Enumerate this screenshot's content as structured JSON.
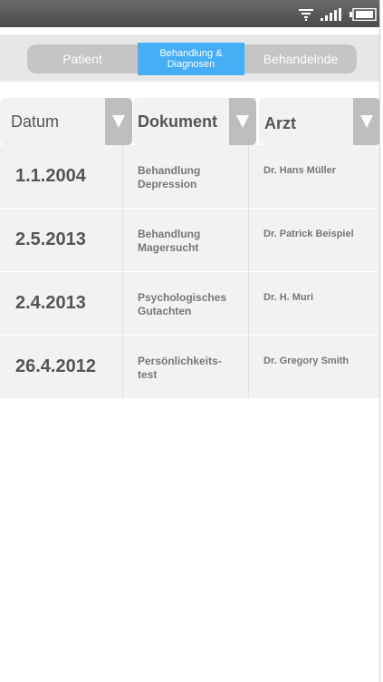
{
  "tabs": [
    {
      "label": "Patient"
    },
    {
      "label_line1": "Behandlung &",
      "label_line2": "Diagnosen"
    },
    {
      "label": "Behandelnde"
    }
  ],
  "table": {
    "headers": {
      "date": "Datum",
      "document": "Dokument",
      "doctor": "Arzt"
    },
    "rows": [
      {
        "date": "1.1.2004",
        "doc_line1": "Behandlung",
        "doc_line2": "Depression",
        "doctor": "Dr. Hans Müller"
      },
      {
        "date": "2.5.2013",
        "doc_line1": "Behandlung",
        "doc_line2": "Magersucht",
        "doctor": "Dr. Patrick Beispiel"
      },
      {
        "date": "2.4.2013",
        "doc_line1": "Psychologisches",
        "doc_line2": "Gutachten",
        "doctor": "Dr. H. Muri"
      },
      {
        "date": "26.4.2012",
        "doc_line1": "Persönlichkeits-",
        "doc_line2": "test",
        "doctor": "Dr. Gregory Smith"
      }
    ]
  },
  "colors": {
    "statusbar": "#555555",
    "tabbar_bg": "#e7e7e7",
    "tab_inactive": "#c5c5c5",
    "tab_active": "#45aef4",
    "cell_bg": "#f2f2f2",
    "sort_button": "#bdbdbd"
  },
  "icons": {
    "status": [
      "wifi-icon",
      "signal-icon",
      "battery-icon"
    ],
    "sort": "triangle-down-icon"
  }
}
